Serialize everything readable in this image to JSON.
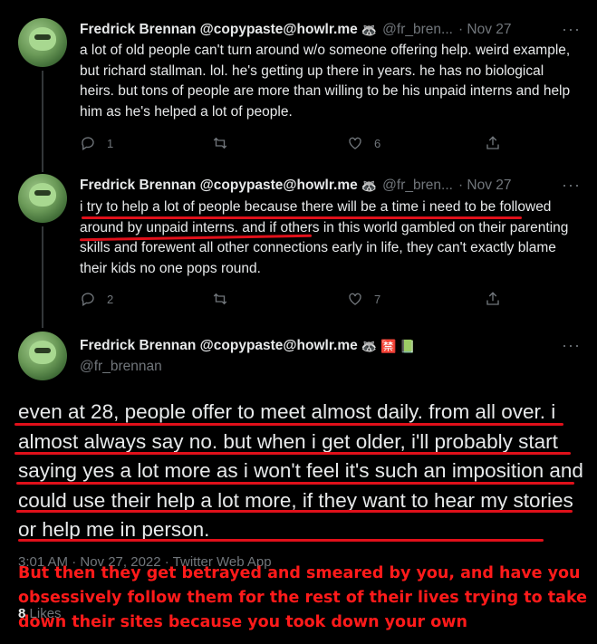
{
  "tweets": [
    {
      "name": "Fredrick Brennan @copypaste@howlr.me",
      "emoji": "🦝",
      "handle": "@fr_bren...",
      "date": "· Nov 27",
      "text": "a lot of old people can't turn around w/o someone offering help. weird example, but richard stallman. lol. he's getting up there in years. he has no biological heirs. but tons of people are more than willing to be his unpaid interns and help him as he's helped a lot of people.",
      "replies": "1",
      "likes": "6"
    },
    {
      "name": "Fredrick Brennan @copypaste@howlr.me",
      "emoji": "🦝",
      "handle": "@fr_bren...",
      "date": "· Nov 27",
      "text": "i try to help a lot of people because there will be a time i need to be followed around by unpaid interns. and if others in this world gambled on their parenting skills and forewent all other connections early in life, they can't exactly blame their kids no one pops round.",
      "replies": "2",
      "likes": "7"
    }
  ],
  "main_tweet": {
    "name": "Fredrick Brennan @copypaste@howlr.me",
    "emoji": "🦝 🈲 📗",
    "handle": "@fr_brennan",
    "text": "even at 28, people offer to meet almost daily. from all over. i almost always say no. but when i get older, i'll probably start saying yes a lot more as i won't feel it's such an imposition and could use their help a lot more, if they want to hear my stories or help me in person.",
    "meta": "3:01 AM · Nov 27, 2022 · Twitter Web App",
    "likes_count": "8",
    "likes_label": "Likes"
  },
  "overlay_text": "But then they get betrayed and smeared by you, and have you obsessively follow them for the rest of their lives trying to take down their sites because you took down your own",
  "more_label": "···",
  "colors": {
    "annotation": "#e0101a",
    "muted": "#71767b",
    "text": "#e7e9ea"
  }
}
